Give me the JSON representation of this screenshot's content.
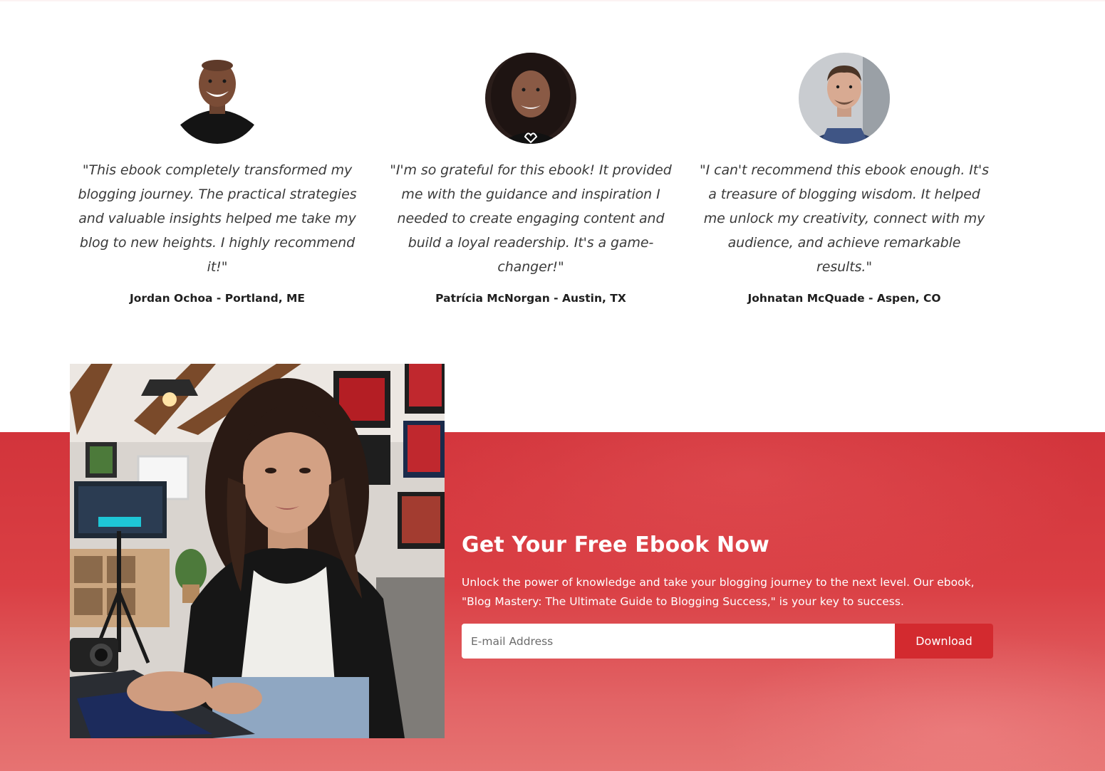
{
  "testimonials": [
    {
      "quote": "\"This ebook completely transformed my blogging journey. The practical strategies and valuable insights helped me take my blog to new heights. I highly recommend it!\"",
      "author": "Jordan Ochoa - Portland, ME"
    },
    {
      "quote": "\"I'm so grateful for this ebook! It provided me with the guidance and inspiration I needed to create engaging content and build a loyal readership. It's a game-changer!\"",
      "author": "Patrícia McNorgan - Austin, TX"
    },
    {
      "quote": "\"I can't recommend this ebook enough. It's a treasure of blogging wisdom. It helped me unlock my creativity, connect with my audience, and achieve remarkable results.\"",
      "author": "Johnatan McQuade - Aspen, CO"
    }
  ],
  "cta": {
    "title": "Get Your Free Ebook Now",
    "text": "Unlock the power of knowledge and take your blogging journey to the next level. Our ebook, \"Blog Mastery: The Ultimate Guide to Blogging Success,\" is your key to success.",
    "email_placeholder": "E-mail Address",
    "email_value": "",
    "button_label": "Download"
  },
  "colors": {
    "accent": "#d32a2f",
    "band": "#da3f44"
  }
}
